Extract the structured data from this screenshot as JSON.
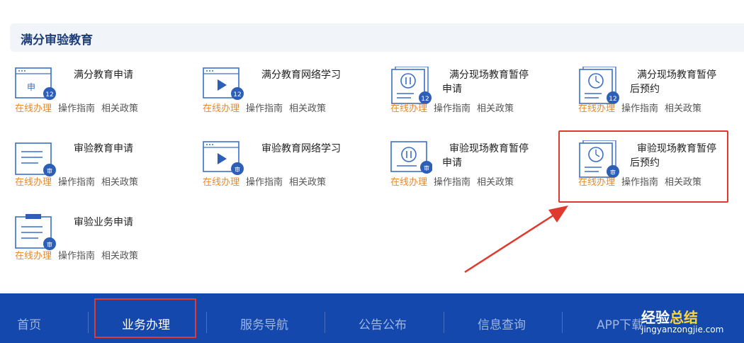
{
  "section": {
    "title": "满分审验教育"
  },
  "services": [
    {
      "id": "s1",
      "line1": "满分教育申请",
      "line2": "",
      "badge": "12",
      "icon": "apply-form-icon"
    },
    {
      "id": "s2",
      "line1": "满分教育网络学习",
      "line2": "",
      "badge": "12",
      "icon": "video-play-icon"
    },
    {
      "id": "s3",
      "line1": "满分现场教育暂停",
      "line2": "申请",
      "badge": "12",
      "icon": "pause-icon"
    },
    {
      "id": "s4",
      "line1": "满分现场教育暂停",
      "line2": "后预约",
      "badge": "12",
      "icon": "clock-icon"
    },
    {
      "id": "s5",
      "line1": "审验教育申请",
      "line2": "",
      "badge": "审",
      "icon": "document-icon"
    },
    {
      "id": "s6",
      "line1": "审验教育网络学习",
      "line2": "",
      "badge": "审",
      "icon": "video-play-icon"
    },
    {
      "id": "s7",
      "line1": "审验现场教育暂停",
      "line2": "申请",
      "badge": "审",
      "icon": "pause-icon"
    },
    {
      "id": "s8",
      "line1": "审验现场教育暂停",
      "line2": "后预约",
      "badge": "审",
      "icon": "clock-icon"
    },
    {
      "id": "s9",
      "line1": "审验业务申请",
      "line2": "",
      "badge": "审",
      "icon": "clipboard-icon"
    }
  ],
  "links": {
    "online": "在线办理",
    "guide": "操作指南",
    "policy": "相关政策"
  },
  "apply_icon_char": "申",
  "nav": {
    "items": [
      "首页",
      "业务办理",
      "服务导航",
      "公告公布",
      "信息查询",
      "APP下载"
    ],
    "active_index": 1
  },
  "watermark": {
    "part1": "经验",
    "part2": "总结",
    "sub": "jingyanzongjie.com"
  },
  "colors": {
    "primary": "#1448ac",
    "icon_blue": "#3a6fc9",
    "online_link": "#e38a2f",
    "highlight": "#e03a2f"
  }
}
